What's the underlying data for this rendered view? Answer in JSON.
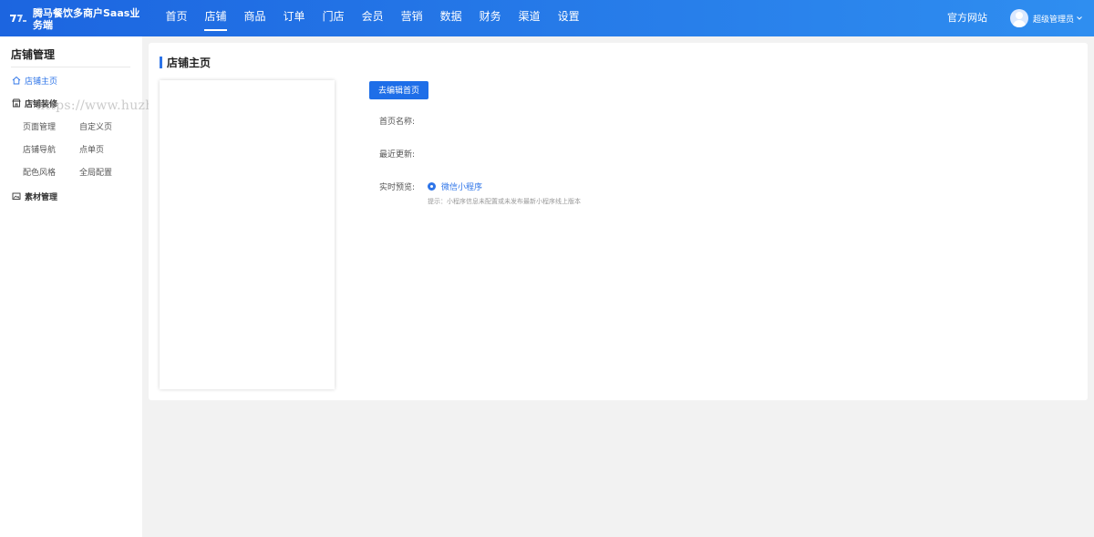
{
  "brand": {
    "name": "腾马餐饮多商户Saas业务端"
  },
  "nav": {
    "items": [
      {
        "label": "首页",
        "active": false
      },
      {
        "label": "店铺",
        "active": true
      },
      {
        "label": "商品",
        "active": false
      },
      {
        "label": "订单",
        "active": false
      },
      {
        "label": "门店",
        "active": false
      },
      {
        "label": "会员",
        "active": false
      },
      {
        "label": "营销",
        "active": false
      },
      {
        "label": "数据",
        "active": false
      },
      {
        "label": "财务",
        "active": false
      },
      {
        "label": "渠道",
        "active": false
      },
      {
        "label": "设置",
        "active": false
      }
    ],
    "official_site": "官方网站",
    "user_name": "超级管理员"
  },
  "sidebar": {
    "title": "店铺管理",
    "home": {
      "label": "店铺主页",
      "icon": "home-icon",
      "active": true
    },
    "decoration": {
      "label": "店铺装修",
      "icon": "store-icon",
      "sub_items": [
        "页面管理",
        "自定义页",
        "店铺导航",
        "点单页",
        "配色风格",
        "全局配置"
      ]
    },
    "materials": {
      "label": "素材管理",
      "icon": "image-icon"
    },
    "watermark": "https://www.huzhan.com/ishop4009"
  },
  "main": {
    "section_title": "店铺主页",
    "edit_button": "去编辑首页",
    "fields": {
      "home_name_label": "首页名称:",
      "last_update_label": "最近更新:",
      "preview_label": "实时预览:"
    },
    "preview_option": "微信小程序",
    "hint": "提示：小程序信息未配置或未发布最新小程序线上版本"
  },
  "colors": {
    "accent": "#2d74e8",
    "header_start": "#1c65e0",
    "header_end": "#2f8ef0",
    "background": "#f2f2f2"
  }
}
